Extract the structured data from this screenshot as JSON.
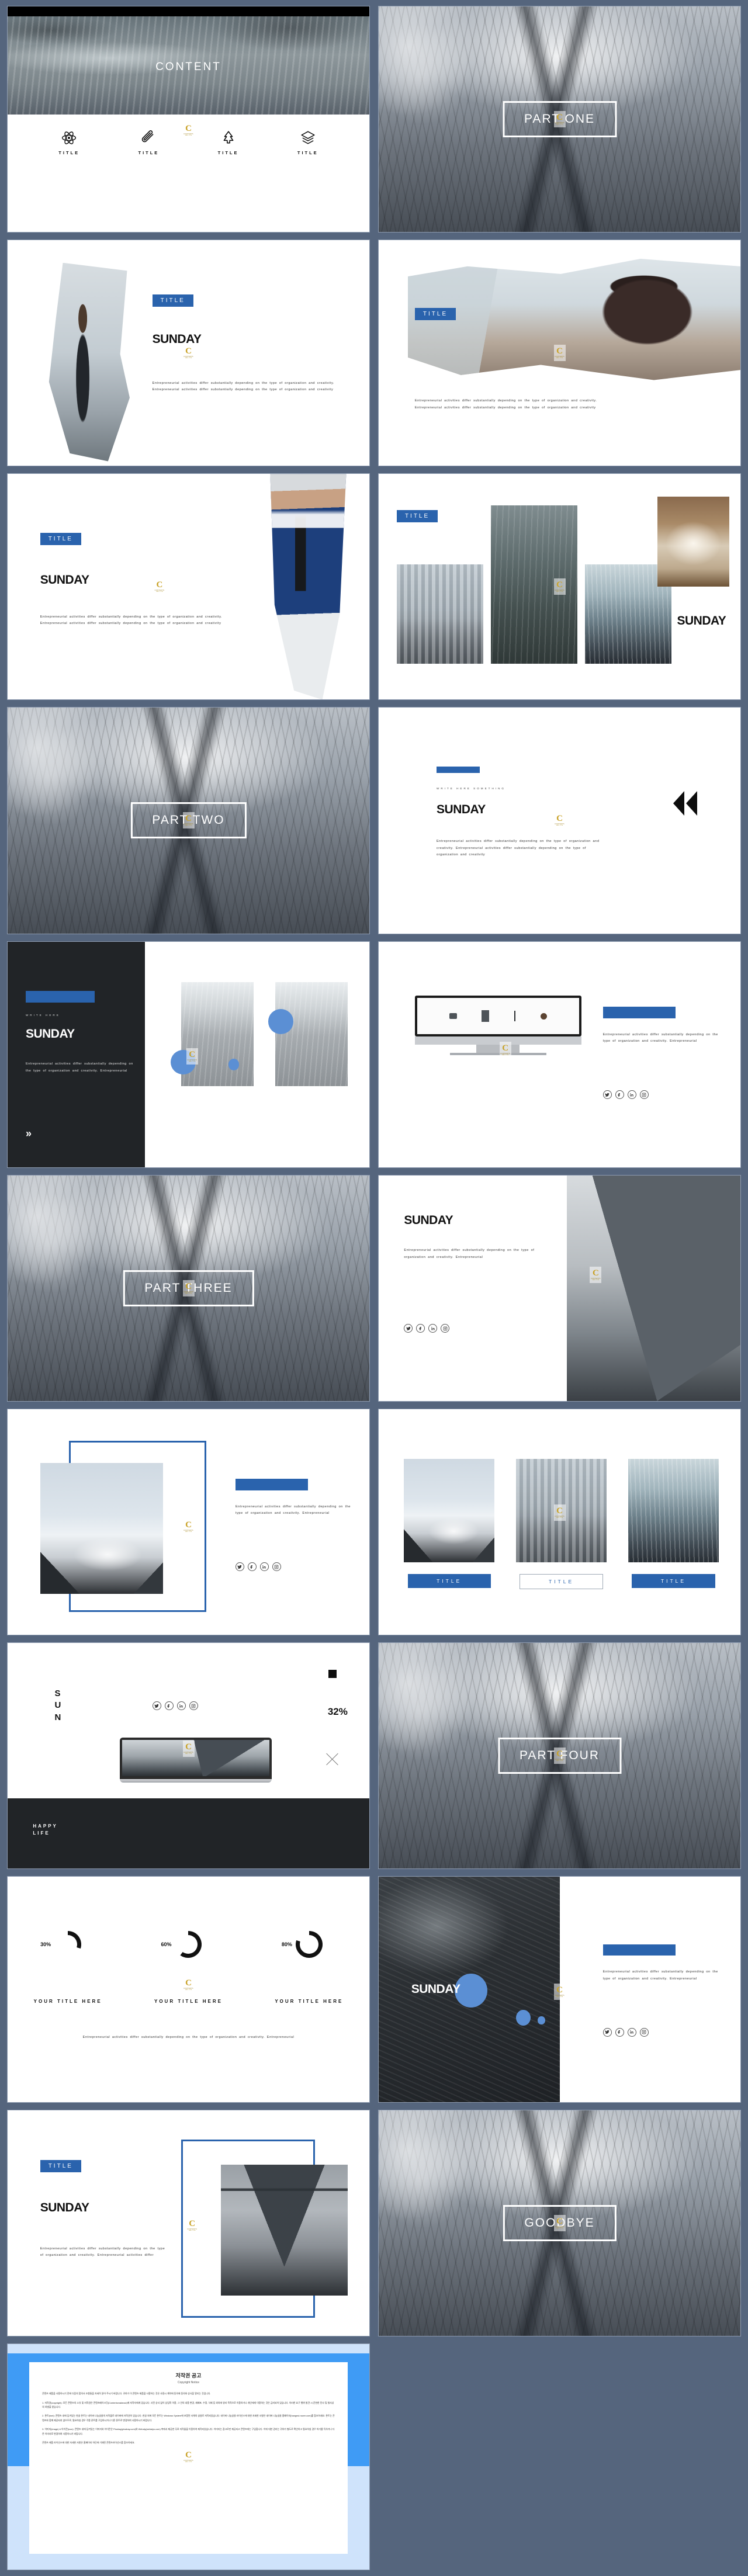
{
  "theme": {
    "page_background": "#55657d",
    "accent_blue": "#2a63ad",
    "light_blue": "#5b8fd4",
    "dark_panel": "#212427",
    "watermark_letter": "C",
    "watermark_line1": "CONTENTS",
    "watermark_line2": "MALL.COM"
  },
  "strings": {
    "title_label": "TITLE",
    "sunday": "SUNDAY",
    "write_here": "WRITE HERE",
    "write_here_something": "WRITE HERE SOMETHING",
    "your_title_here": "YOUR TITLE HERE",
    "happy": "HAPPY",
    "life": "LIFE",
    "body_long": "Entrepreneurial activities differ substantially depending on the type of organization and creativity. Entrepreneurial activities differ substantially depending on the type of organization and creativity",
    "body_med": "Entrepreneurial activities differ substantially depending on the type of organization and creativity. Entrepreneurial activities differ",
    "body_short": "Entrepreneurial activities differ substantially depending on the type of organization and creativity. Entrepreneurial",
    "body_two_line": "Entrepreneurial activities differ substantially depending on the type of organization and creativity. Entrepreneurial",
    "s_letter": "S",
    "u_letter": "U",
    "n_letter": "N",
    "pct_32": "32%"
  },
  "slides": [
    {
      "n": 1,
      "name": "content-overview",
      "title": "CONTENT",
      "icons": [
        {
          "name": "atom-icon",
          "label": "TITLE"
        },
        {
          "name": "paperclip-icon",
          "label": "TITLE"
        },
        {
          "name": "tree-icon",
          "label": "TITLE"
        },
        {
          "name": "layers-icon",
          "label": "TITLE"
        }
      ]
    },
    {
      "n": 2,
      "name": "part-one-divider",
      "title": "PART ONE"
    },
    {
      "n": 3,
      "name": "title-sunday-left-photo",
      "chip": "TITLE",
      "heading": "SUNDAY"
    },
    {
      "n": 4,
      "name": "title-photo-top",
      "chip": "TITLE"
    },
    {
      "n": 5,
      "name": "title-sunday-businessman",
      "chip": "TITLE",
      "heading": "SUNDAY"
    },
    {
      "n": 6,
      "name": "title-photo-grid",
      "chip": "TITLE",
      "heading": "SUNDAY"
    },
    {
      "n": 7,
      "name": "part-two-divider",
      "title": "PART TWO"
    },
    {
      "n": 8,
      "name": "sunday-quote",
      "eyebrow": "WRITE HERE SOMETHING",
      "heading": "SUNDAY"
    },
    {
      "n": 9,
      "name": "dark-sunday-two-photos",
      "eyebrow": "WRITE HERE",
      "heading": "SUNDAY"
    },
    {
      "n": 10,
      "name": "desktop-monitor-mockup"
    },
    {
      "n": 11,
      "name": "part-three-divider",
      "title": "PART THREE"
    },
    {
      "n": 12,
      "name": "sunday-right-photo",
      "heading": "SUNDAY"
    },
    {
      "n": 13,
      "name": "mountain-blue-frame"
    },
    {
      "n": 14,
      "name": "three-photo-titles",
      "buttons": [
        {
          "label": "TITLE",
          "style": "filled"
        },
        {
          "label": "TITLE",
          "style": "outline"
        },
        {
          "label": "TITLE",
          "style": "filled"
        }
      ]
    },
    {
      "n": 15,
      "name": "sun-laptop-stats",
      "pct": "32%",
      "caption_1": "HAPPY",
      "caption_2": "LIFE"
    },
    {
      "n": 16,
      "name": "part-four-divider",
      "title": "PART FOUR"
    },
    {
      "n": 17,
      "name": "donut-percentages",
      "donuts": [
        {
          "pct": "30%",
          "value": 30,
          "label": "YOUR TITLE HERE"
        },
        {
          "pct": "60%",
          "value": 60,
          "label": "YOUR TITLE HERE"
        },
        {
          "pct": "80%",
          "value": 80,
          "label": "YOUR TITLE HERE"
        }
      ]
    },
    {
      "n": 18,
      "name": "sunday-shipwreck-split",
      "heading": "SUNDAY"
    },
    {
      "n": 19,
      "name": "title-sunday-eiffel",
      "chip": "TITLE",
      "heading": "SUNDAY"
    },
    {
      "n": 20,
      "name": "goodbye-divider",
      "title": "GOODBYE"
    },
    {
      "n": 21,
      "name": "copyright-notice"
    }
  ],
  "chart_data": {
    "type": "pie",
    "title": "YOUR TITLE HERE",
    "categories": [
      "YOUR TITLE HERE",
      "YOUR TITLE HERE",
      "YOUR TITLE HERE"
    ],
    "values": [
      30,
      60,
      80
    ],
    "labels": [
      "30%",
      "60%",
      "80%"
    ],
    "ylim": [
      0,
      100
    ],
    "legend": "none",
    "note": "Three ring/donut progress indicators rendered as partially-filled circles",
    "extra_value": {
      "label": "32%",
      "value": 32
    }
  },
  "social": [
    {
      "name": "twitter-icon",
      "label": "Twitter"
    },
    {
      "name": "facebook-icon",
      "label": "Facebook"
    },
    {
      "name": "linkedin-icon",
      "label": "LinkedIn"
    },
    {
      "name": "instagram-icon",
      "label": "Instagram"
    }
  ],
  "copyright": {
    "title": "저작권 공고",
    "subtitle": "Copyright Notice",
    "intro": "콘텐츠 제품을 사용하시기 전에 다음의 합의서 조항들을 자세히 읽어 주시기 바랍니다. 귀하가 이 콘텐츠 제품을 사용하는 것은 사용시 계약에 동의에 동의와 승낙을 알리는 것입니다.",
    "p1": "1. 저작권(copyright): 모든 콘텐츠의 소유 및 저작권은 콘텐츠메이크것(Contentsmakeout)에 저작자에게 있습니다. 사전 승낙 없이 상업적 이용, 그 안의 내용 변경, 재배포, 수정, 삭제 등 외의에 영리 목적으로 이용하거나 개인에게 이용하는 것은 금지되어 있습니다. 이러한 요구 행위 발견 시 준한한 민사 및 형사상의 처벌을 받습니다.",
    "p2": "2. 폰트(font): 콘텐츠 내에 담겨있는 한글 폰트는 네이버 나눔글꼴의 저작물로 네이버에 저작권이 있습니다. 한글 외에 모든 폰트는 Windows System에 포함된 서체의 글꼴로 저작되었습니다. 네이버 나눔글꼴 라이선스에 대한 자세한 사항은 네이버 나눔글꼴 홈페이지(hangeul.naver.com)를 참조하세요. 폰트는 콘텐츠와 함께 제공되지 않으므로, 필요하실 경우 각종 폰트를 구입하시거나 다른 폰트로 변경하여 사용하시기 바랍니다.",
    "p3": "3. 이미지(image) & 아이콘(icon): 콘텐츠 내에 담겨있는 이미지와 아이콘은 Pixabay(pixabay.com)와 Webaly(webalys.com) 측에서 제공한 무료 저작물을 이용하여 제작되었습니다. 이미지는 참고로만 제공되고 콘텐츠에는 구입합니다. 이에 대한 권리는 귀하가 별도로 확인하고 필요하실 경우 허가를 득하거나 다른 이미지로 변경하여 사용하시기 바랍니다.",
    "outro": "콘텐츠 제품 라이선스에 대한 자세한 사항은 홈페이지 하단에 기재된 콘텐츠라이선스를 참조하세요."
  }
}
